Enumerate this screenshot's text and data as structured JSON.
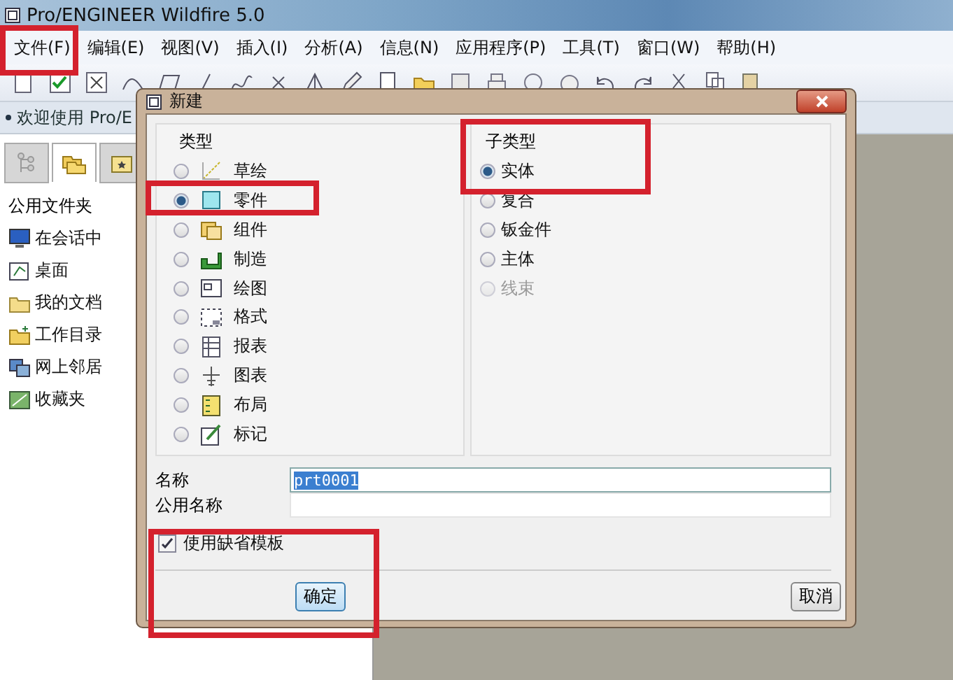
{
  "window": {
    "title": "Pro/ENGINEER Wildfire 5.0"
  },
  "menu": [
    "文件(F)",
    "编辑(E)",
    "视图(V)",
    "插入(I)",
    "分析(A)",
    "信息(N)",
    "应用程序(P)",
    "工具(T)",
    "窗口(W)",
    "帮助(H)"
  ],
  "navigator": {
    "header": "欢迎使用 Pro/E",
    "tabs": [
      {
        "kind": "tree",
        "selected": false
      },
      {
        "kind": "folders",
        "selected": true
      },
      {
        "kind": "favorites",
        "selected": false
      }
    ],
    "folder_title": "公用文件夹",
    "folders": [
      {
        "label": "在会话中",
        "kind": "session"
      },
      {
        "label": "桌面",
        "kind": "desktop"
      },
      {
        "label": "我的文档",
        "kind": "documents"
      },
      {
        "label": "工作目录",
        "kind": "workdir"
      },
      {
        "label": "网上邻居",
        "kind": "network"
      },
      {
        "label": "收藏夹",
        "kind": "favorites"
      }
    ]
  },
  "dialog": {
    "title": "新建",
    "type_group": {
      "title": "类型",
      "options": [
        {
          "label": "草绘",
          "kind": "sketch",
          "selected": false
        },
        {
          "label": "零件",
          "kind": "part",
          "selected": true
        },
        {
          "label": "组件",
          "kind": "assembly",
          "selected": false
        },
        {
          "label": "制造",
          "kind": "manufacturing",
          "selected": false
        },
        {
          "label": "绘图",
          "kind": "drawing",
          "selected": false
        },
        {
          "label": "格式",
          "kind": "format",
          "selected": false
        },
        {
          "label": "报表",
          "kind": "report",
          "selected": false
        },
        {
          "label": "图表",
          "kind": "diagram",
          "selected": false
        },
        {
          "label": "布局",
          "kind": "layout",
          "selected": false
        },
        {
          "label": "标记",
          "kind": "markup",
          "selected": false
        }
      ]
    },
    "subtype_group": {
      "title": "子类型",
      "options": [
        {
          "label": "实体",
          "selected": true,
          "disabled": false
        },
        {
          "label": "复合",
          "selected": false,
          "disabled": false
        },
        {
          "label": "钣金件",
          "selected": false,
          "disabled": false
        },
        {
          "label": "主体",
          "selected": false,
          "disabled": false
        },
        {
          "label": "线束",
          "selected": false,
          "disabled": true
        }
      ]
    },
    "name": {
      "label": "名称",
      "value": "prt0001",
      "selected": true
    },
    "common_name": {
      "label": "公用名称"
    },
    "use_default_template": {
      "label": "使用缺省模板",
      "checked": true
    },
    "buttons": [
      {
        "label": "确定",
        "default": true
      },
      {
        "label": "取消",
        "default": false
      }
    ]
  }
}
